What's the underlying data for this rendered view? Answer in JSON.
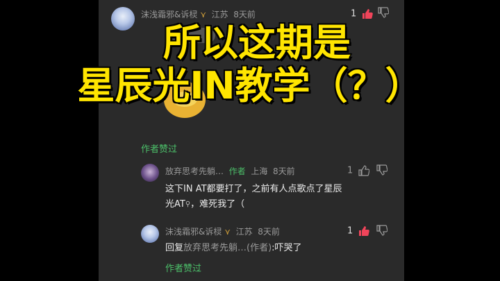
{
  "comment1": {
    "user": "沫浅霜邪&诉棂",
    "badge_icon": "wheat-badge-icon",
    "location": "江苏",
    "time": "8天前",
    "likes": "1",
    "author_liked": "作者赞过"
  },
  "reply1": {
    "user": "放弃思考先躺…",
    "author_tag": "作者",
    "location": "上海",
    "time": "8天前",
    "likes": "1",
    "text_line1": "这下IN AT都要打了，之前有人点歌点了星辰",
    "text_line2_pre": "光AT",
    "text_line2_post": "，难死我了（"
  },
  "reply2": {
    "user": "沫浅霜邪&诉棂",
    "location": "江苏",
    "time": "8天前",
    "likes": "1",
    "reply_prefix": "回复",
    "reply_target": "放弃思考先躺…(作者)",
    "reply_text": ":吓哭了",
    "author_liked": "作者赞过"
  },
  "overlay": {
    "line1": "所以这期是",
    "line2": "星辰光IN教学（？）"
  },
  "colors": {
    "accent_green": "#4cc06a",
    "like_red": "#f0445a",
    "overlay_yellow": "#ffe500"
  }
}
